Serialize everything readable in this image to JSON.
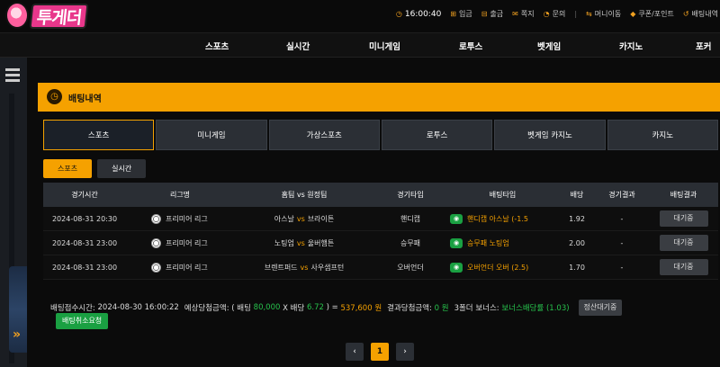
{
  "brand": {
    "logo_text": "투게더"
  },
  "topbar": {
    "time": "16:00:40",
    "links": [
      {
        "icon": "plus-square-icon",
        "label": "입금"
      },
      {
        "icon": "minus-square-icon",
        "label": "출금"
      },
      {
        "icon": "envelope-icon",
        "label": "쪽지"
      },
      {
        "icon": "chat-icon",
        "label": "문의"
      },
      {
        "icon": "transfer-icon",
        "label": "머니이동"
      },
      {
        "icon": "tag-icon",
        "label": "쿠폰/포인트"
      },
      {
        "icon": "history-icon",
        "label": "배팅내역"
      }
    ]
  },
  "nav": {
    "items": [
      "스포츠",
      "실시간",
      "미니게임",
      "로투스",
      "벳게임",
      "카지노",
      "포커"
    ]
  },
  "page": {
    "title": "배팅내역"
  },
  "tabs": [
    "스포츠",
    "미니게임",
    "가상스포츠",
    "로투스",
    "벳게임 카지노",
    "카지노"
  ],
  "subtabs": [
    "스포츠",
    "실시간"
  ],
  "table": {
    "headers": [
      "경기시간",
      "리그명",
      "홈팀 vs 원정팀",
      "경기타입",
      "배팅타입",
      "배당",
      "경기결과",
      "배팅결과"
    ],
    "vs_label": "vs",
    "rows": [
      {
        "time": "2024-08-31 20:30",
        "league": "프리미어 리그",
        "home": "아스날",
        "away": "브라이튼",
        "type": "핸디캡",
        "bet": "핸디캡 아스날 (-1.5",
        "odds": "1.92",
        "result": "-",
        "status": "대기중"
      },
      {
        "time": "2024-08-31 23:00",
        "league": "프리미어 리그",
        "home": "노팅엄",
        "away": "울버햄튼",
        "type": "승무패",
        "bet": "승무패 노팅엄",
        "odds": "2.00",
        "result": "-",
        "status": "대기중"
      },
      {
        "time": "2024-08-31 23:00",
        "league": "프리미어 리그",
        "home": "브렌트퍼드",
        "away": "사우샘프턴",
        "type": "오버언더",
        "bet": "오버언더 오버 (2.5)",
        "odds": "1.70",
        "result": "-",
        "status": "대기중"
      }
    ]
  },
  "summary": {
    "time_label": "배팅접수시간:",
    "time_value": "2024-08-30 16:00:22",
    "expected_label": "예상당첨금액:",
    "bet_open": "( 배팅",
    "bet_amount": "80,000",
    "times": "X 배당",
    "odds": "6.72",
    "eq": ") =",
    "expected_amount": "537,600 원",
    "result_label": "결과당첨금액:",
    "result_amount": "0 원",
    "bonus_label": "3폴더 보너스:",
    "bonus_value": "보너스배당률 (1.03)",
    "pending_button": "정산대기중",
    "cancel_button": "배팅취소요청"
  },
  "pagination": {
    "prev": "‹",
    "current": "1",
    "next": "›"
  },
  "colors": {
    "accent": "#f5a100",
    "green": "#1aa042",
    "background": "#0b0b0b"
  }
}
